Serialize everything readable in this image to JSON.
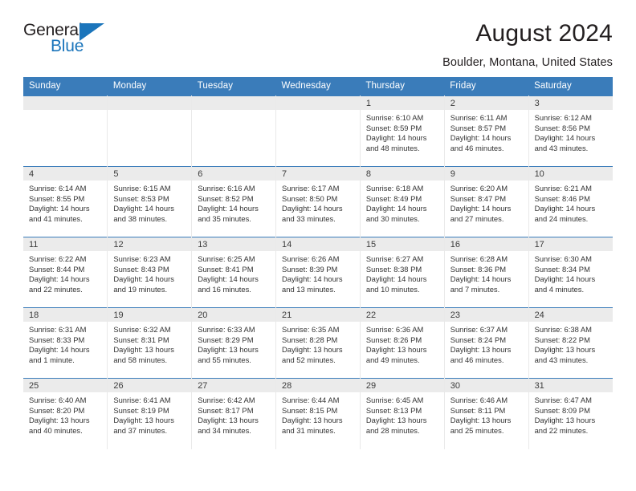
{
  "brand": {
    "word1": "General",
    "word2": "Blue",
    "accent_color": "#1b75bb",
    "triangle_icon": "triangle-icon"
  },
  "header": {
    "title": "August 2024",
    "subtitle": "Boulder, Montana, United States",
    "header_bg_color": "#3a7cba",
    "day_band_color": "#ebebeb"
  },
  "weekday_headers": [
    "Sunday",
    "Monday",
    "Tuesday",
    "Wednesday",
    "Thursday",
    "Friday",
    "Saturday"
  ],
  "labels": {
    "sunrise": "Sunrise:",
    "sunset": "Sunset:",
    "daylight": "Daylight:"
  },
  "weeks": [
    [
      {
        "day": "",
        "empty": true
      },
      {
        "day": "",
        "empty": true
      },
      {
        "day": "",
        "empty": true
      },
      {
        "day": "",
        "empty": true
      },
      {
        "day": "1",
        "sunrise": "Sunrise: 6:10 AM",
        "sunset": "Sunset: 8:59 PM",
        "daylight1": "Daylight: 14 hours",
        "daylight2": "and 48 minutes."
      },
      {
        "day": "2",
        "sunrise": "Sunrise: 6:11 AM",
        "sunset": "Sunset: 8:57 PM",
        "daylight1": "Daylight: 14 hours",
        "daylight2": "and 46 minutes."
      },
      {
        "day": "3",
        "sunrise": "Sunrise: 6:12 AM",
        "sunset": "Sunset: 8:56 PM",
        "daylight1": "Daylight: 14 hours",
        "daylight2": "and 43 minutes."
      }
    ],
    [
      {
        "day": "4",
        "sunrise": "Sunrise: 6:14 AM",
        "sunset": "Sunset: 8:55 PM",
        "daylight1": "Daylight: 14 hours",
        "daylight2": "and 41 minutes."
      },
      {
        "day": "5",
        "sunrise": "Sunrise: 6:15 AM",
        "sunset": "Sunset: 8:53 PM",
        "daylight1": "Daylight: 14 hours",
        "daylight2": "and 38 minutes."
      },
      {
        "day": "6",
        "sunrise": "Sunrise: 6:16 AM",
        "sunset": "Sunset: 8:52 PM",
        "daylight1": "Daylight: 14 hours",
        "daylight2": "and 35 minutes."
      },
      {
        "day": "7",
        "sunrise": "Sunrise: 6:17 AM",
        "sunset": "Sunset: 8:50 PM",
        "daylight1": "Daylight: 14 hours",
        "daylight2": "and 33 minutes."
      },
      {
        "day": "8",
        "sunrise": "Sunrise: 6:18 AM",
        "sunset": "Sunset: 8:49 PM",
        "daylight1": "Daylight: 14 hours",
        "daylight2": "and 30 minutes."
      },
      {
        "day": "9",
        "sunrise": "Sunrise: 6:20 AM",
        "sunset": "Sunset: 8:47 PM",
        "daylight1": "Daylight: 14 hours",
        "daylight2": "and 27 minutes."
      },
      {
        "day": "10",
        "sunrise": "Sunrise: 6:21 AM",
        "sunset": "Sunset: 8:46 PM",
        "daylight1": "Daylight: 14 hours",
        "daylight2": "and 24 minutes."
      }
    ],
    [
      {
        "day": "11",
        "sunrise": "Sunrise: 6:22 AM",
        "sunset": "Sunset: 8:44 PM",
        "daylight1": "Daylight: 14 hours",
        "daylight2": "and 22 minutes."
      },
      {
        "day": "12",
        "sunrise": "Sunrise: 6:23 AM",
        "sunset": "Sunset: 8:43 PM",
        "daylight1": "Daylight: 14 hours",
        "daylight2": "and 19 minutes."
      },
      {
        "day": "13",
        "sunrise": "Sunrise: 6:25 AM",
        "sunset": "Sunset: 8:41 PM",
        "daylight1": "Daylight: 14 hours",
        "daylight2": "and 16 minutes."
      },
      {
        "day": "14",
        "sunrise": "Sunrise: 6:26 AM",
        "sunset": "Sunset: 8:39 PM",
        "daylight1": "Daylight: 14 hours",
        "daylight2": "and 13 minutes."
      },
      {
        "day": "15",
        "sunrise": "Sunrise: 6:27 AM",
        "sunset": "Sunset: 8:38 PM",
        "daylight1": "Daylight: 14 hours",
        "daylight2": "and 10 minutes."
      },
      {
        "day": "16",
        "sunrise": "Sunrise: 6:28 AM",
        "sunset": "Sunset: 8:36 PM",
        "daylight1": "Daylight: 14 hours",
        "daylight2": "and 7 minutes."
      },
      {
        "day": "17",
        "sunrise": "Sunrise: 6:30 AM",
        "sunset": "Sunset: 8:34 PM",
        "daylight1": "Daylight: 14 hours",
        "daylight2": "and 4 minutes."
      }
    ],
    [
      {
        "day": "18",
        "sunrise": "Sunrise: 6:31 AM",
        "sunset": "Sunset: 8:33 PM",
        "daylight1": "Daylight: 14 hours",
        "daylight2": "and 1 minute."
      },
      {
        "day": "19",
        "sunrise": "Sunrise: 6:32 AM",
        "sunset": "Sunset: 8:31 PM",
        "daylight1": "Daylight: 13 hours",
        "daylight2": "and 58 minutes."
      },
      {
        "day": "20",
        "sunrise": "Sunrise: 6:33 AM",
        "sunset": "Sunset: 8:29 PM",
        "daylight1": "Daylight: 13 hours",
        "daylight2": "and 55 minutes."
      },
      {
        "day": "21",
        "sunrise": "Sunrise: 6:35 AM",
        "sunset": "Sunset: 8:28 PM",
        "daylight1": "Daylight: 13 hours",
        "daylight2": "and 52 minutes."
      },
      {
        "day": "22",
        "sunrise": "Sunrise: 6:36 AM",
        "sunset": "Sunset: 8:26 PM",
        "daylight1": "Daylight: 13 hours",
        "daylight2": "and 49 minutes."
      },
      {
        "day": "23",
        "sunrise": "Sunrise: 6:37 AM",
        "sunset": "Sunset: 8:24 PM",
        "daylight1": "Daylight: 13 hours",
        "daylight2": "and 46 minutes."
      },
      {
        "day": "24",
        "sunrise": "Sunrise: 6:38 AM",
        "sunset": "Sunset: 8:22 PM",
        "daylight1": "Daylight: 13 hours",
        "daylight2": "and 43 minutes."
      }
    ],
    [
      {
        "day": "25",
        "sunrise": "Sunrise: 6:40 AM",
        "sunset": "Sunset: 8:20 PM",
        "daylight1": "Daylight: 13 hours",
        "daylight2": "and 40 minutes."
      },
      {
        "day": "26",
        "sunrise": "Sunrise: 6:41 AM",
        "sunset": "Sunset: 8:19 PM",
        "daylight1": "Daylight: 13 hours",
        "daylight2": "and 37 minutes."
      },
      {
        "day": "27",
        "sunrise": "Sunrise: 6:42 AM",
        "sunset": "Sunset: 8:17 PM",
        "daylight1": "Daylight: 13 hours",
        "daylight2": "and 34 minutes."
      },
      {
        "day": "28",
        "sunrise": "Sunrise: 6:44 AM",
        "sunset": "Sunset: 8:15 PM",
        "daylight1": "Daylight: 13 hours",
        "daylight2": "and 31 minutes."
      },
      {
        "day": "29",
        "sunrise": "Sunrise: 6:45 AM",
        "sunset": "Sunset: 8:13 PM",
        "daylight1": "Daylight: 13 hours",
        "daylight2": "and 28 minutes."
      },
      {
        "day": "30",
        "sunrise": "Sunrise: 6:46 AM",
        "sunset": "Sunset: 8:11 PM",
        "daylight1": "Daylight: 13 hours",
        "daylight2": "and 25 minutes."
      },
      {
        "day": "31",
        "sunrise": "Sunrise: 6:47 AM",
        "sunset": "Sunset: 8:09 PM",
        "daylight1": "Daylight: 13 hours",
        "daylight2": "and 22 minutes."
      }
    ]
  ]
}
